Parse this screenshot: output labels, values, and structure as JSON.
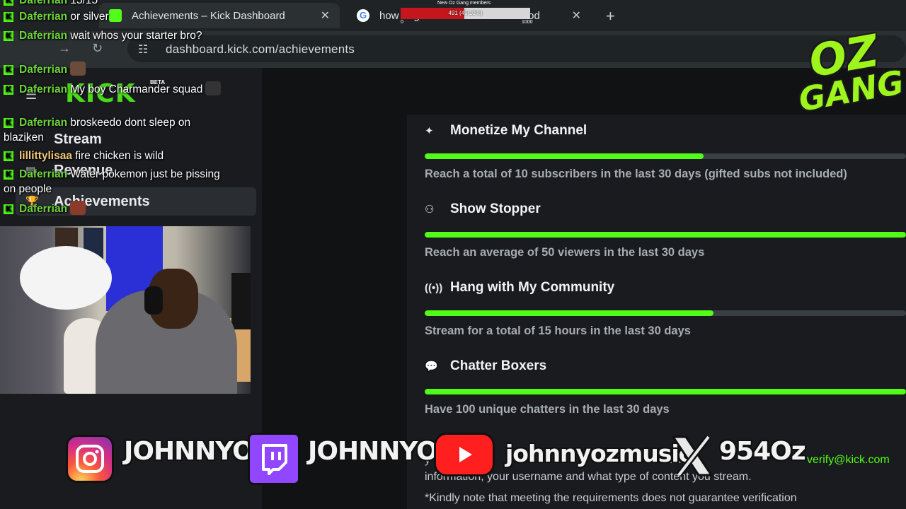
{
  "browser": {
    "tabs": [
      {
        "title": "Achievements – Kick Dashboard",
        "close": "✕"
      },
      {
        "title": "how to get monetized on kick mod",
        "close": "✕"
      }
    ],
    "new_tab": "+",
    "url": "dashboard.kick.com/achievements"
  },
  "goal": {
    "title": "New Oz Gang members",
    "label": "491 (49.10%)",
    "progress_percent": 49.1,
    "min": "0",
    "max": "1000",
    "fill_color": "#c4161c"
  },
  "dashboard": {
    "logo": "KICK",
    "beta": "BETA",
    "sidebar": [
      {
        "label": "Stream",
        "icon": "chevron-right-icon"
      },
      {
        "label": "Revenue",
        "icon": "wallet-icon"
      },
      {
        "label": "Achievements",
        "icon": "trophy-icon",
        "active": true
      }
    ],
    "achievements": [
      {
        "title": "Monetize My Channel",
        "icon": "sparkle-icon",
        "progress": 0.58,
        "description": "Reach a total of 10 subscribers in the last 30 days (gifted subs not included)"
      },
      {
        "title": "Show Stopper",
        "icon": "users-icon",
        "progress": 1.0,
        "description": "Reach an average of 50 viewers in the last 30 days"
      },
      {
        "title": "Hang with My Community",
        "icon": "broadcast-icon",
        "progress": 0.6,
        "description": "Stream for a total of 15 hours in the last 30 days"
      },
      {
        "title": "Chatter Boxers",
        "icon": "chat-bubble-icon",
        "progress": 1.0,
        "description": "Have 100 unique chatters in the last 30 days"
      }
    ],
    "notes": {
      "email_fragment": "verify@kick.com",
      "line1_fragment": "em",
      "line1_prefix": "y",
      "line2": "information, your username and what type of content you stream.",
      "line3": "*Kindly note that meeting the requirements does not guarantee verification"
    },
    "accent": "#53fc18"
  },
  "chat": [
    {
      "user": "Daferrian",
      "text": "15/15"
    },
    {
      "user": "Daferrian",
      "text": "or silver"
    },
    {
      "user": "Daferrian",
      "text": "wait whos your starter bro?"
    },
    {
      "user": "Daferrian",
      "text": ""
    },
    {
      "user": "Daferrian",
      "text": "My boy Charmander squad"
    },
    {
      "user": "Daferrian",
      "text": "broskeedo dont sleep on blaziken"
    },
    {
      "user": "lillittylisaa",
      "text": "fire chicken is wild"
    },
    {
      "user": "Daferrian",
      "text": "Water pokemon just be pissing on people"
    },
    {
      "user": "Daferrian",
      "text": ""
    }
  ],
  "overlay": {
    "brand_line1": "OZ",
    "brand_line2": "GANG",
    "socials": [
      {
        "platform": "instagram-icon",
        "handle": "JOHNNYOZ"
      },
      {
        "platform": "twitch-icon",
        "handle": "JOHNNYOZ"
      },
      {
        "platform": "youtube-icon",
        "handle": "johnnyozmusic"
      },
      {
        "platform": "x-icon",
        "handle": "954Oz"
      }
    ]
  }
}
